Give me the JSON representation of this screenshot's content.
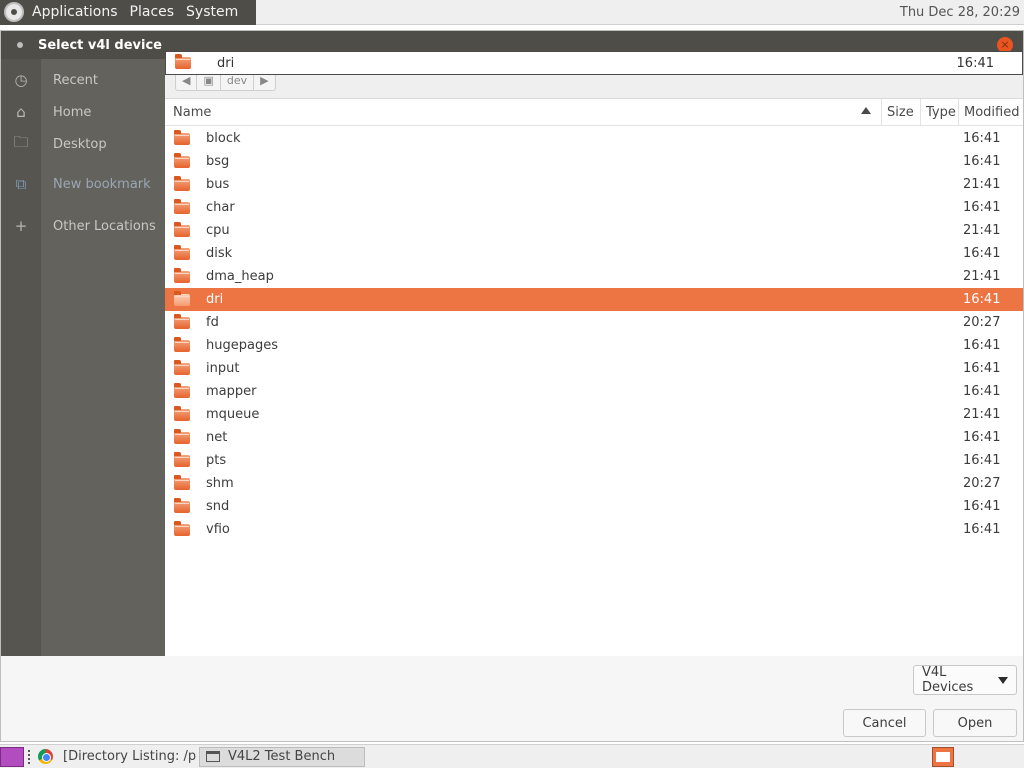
{
  "top_panel": {
    "menus": [
      "Applications",
      "Places",
      "System"
    ],
    "clock": "Thu Dec 28, 20:29"
  },
  "dialog": {
    "title": "Select v4l device",
    "close_label": "×"
  },
  "sidebar": {
    "items": [
      {
        "label": "Recent",
        "icon": "clock-icon"
      },
      {
        "label": "Home",
        "icon": "home-icon"
      },
      {
        "label": "Desktop",
        "icon": "folder-icon"
      },
      {
        "label": "New bookmark",
        "icon": "bookmark-add-icon"
      },
      {
        "label": "Other Locations",
        "icon": "plus-icon"
      }
    ]
  },
  "pathbar": {
    "segment": "dev"
  },
  "location_popup": {
    "name": "dri",
    "time": "16:41"
  },
  "columns": {
    "name": "Name",
    "size": "Size",
    "type": "Type",
    "modified": "Modified"
  },
  "files": [
    {
      "name": "block",
      "modified": "16:41"
    },
    {
      "name": "bsg",
      "modified": "16:41"
    },
    {
      "name": "bus",
      "modified": "21:41"
    },
    {
      "name": "char",
      "modified": "16:41"
    },
    {
      "name": "cpu",
      "modified": "21:41"
    },
    {
      "name": "disk",
      "modified": "16:41"
    },
    {
      "name": "dma_heap",
      "modified": "21:41"
    },
    {
      "name": "dri",
      "modified": "16:41"
    },
    {
      "name": "fd",
      "modified": "20:27"
    },
    {
      "name": "hugepages",
      "modified": "16:41"
    },
    {
      "name": "input",
      "modified": "16:41"
    },
    {
      "name": "mapper",
      "modified": "16:41"
    },
    {
      "name": "mqueue",
      "modified": "21:41"
    },
    {
      "name": "net",
      "modified": "16:41"
    },
    {
      "name": "pts",
      "modified": "16:41"
    },
    {
      "name": "shm",
      "modified": "20:27"
    },
    {
      "name": "snd",
      "modified": "16:41"
    },
    {
      "name": "vfio",
      "modified": "16:41"
    }
  ],
  "selected_file": "dri",
  "filter": {
    "value": "V4L Devices"
  },
  "buttons": {
    "cancel": "Cancel",
    "open": "Open"
  },
  "taskbar": {
    "tasks": [
      "[Directory Listing: /p...",
      "V4L2 Test Bench"
    ]
  },
  "colors": {
    "accent": "#ed7543",
    "titlebar": "#4e4d47",
    "sidebar": "#63625c"
  }
}
